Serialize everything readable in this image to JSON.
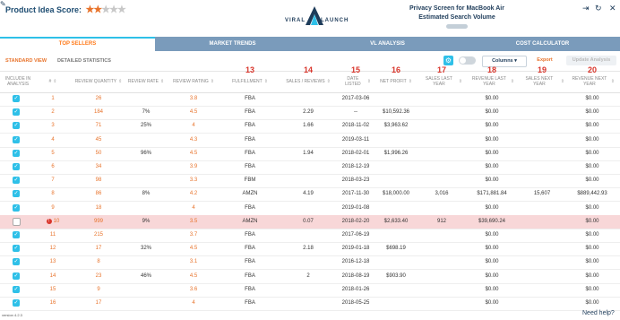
{
  "header": {
    "score_label": "Product Idea Score:",
    "stars": [
      "on",
      "on",
      "off",
      "off",
      "off"
    ],
    "logo_left": "VIRAL",
    "logo_right": "LAUNCH",
    "product_title": "Privacy Screen for MacBook Air",
    "product_subtitle": "Estimated Search Volume",
    "export_icon": "⇥",
    "refresh_icon": "↻",
    "close_icon": "✕"
  },
  "tabs": [
    {
      "label": "TOP SELLERS",
      "active": true
    },
    {
      "label": "MARKET TRENDS",
      "active": false
    },
    {
      "label": "VL ANALYSIS",
      "active": false
    },
    {
      "label": "COST CALCULATOR",
      "active": false
    }
  ],
  "toolbar": {
    "standard_view": "STANDARD VIEW",
    "detailed_statistics": "DETAILED STATISTICS",
    "gear_icon": "⚙",
    "columns_label": "Columns ▾",
    "export_label": "Export",
    "update_label": "Update Analysis"
  },
  "columns": {
    "include": "INCLUDE IN ANALYSIS",
    "num": "#",
    "review_qty": "REVIEW QUANTITY",
    "review_rate": "REVIEW RATE",
    "review_rating": "REVIEW RATING",
    "fulfillment": "FULFILLMENT",
    "sales_reviews": "SALES / REVIEWS",
    "date_listed": "DATE LISTED",
    "net_profit": "NET PROFIT",
    "sales_last_year": "SALES LAST YEAR",
    "revenue_last_year": "REVENUE LAST YEAR",
    "sales_next_year": "SALES NEXT YEAR",
    "revenue_next_year": "REVENUE NEXT YEAR"
  },
  "column_annotations": [
    "13",
    "14",
    "15",
    "16",
    "17",
    "18",
    "19",
    "20"
  ],
  "rows": [
    {
      "checked": true,
      "n": "1",
      "qty": "26",
      "rate": "",
      "rating": "3.8",
      "ful": "FBA",
      "sr": "",
      "date": "2017-03-06",
      "np": "",
      "sly": "",
      "rly": "$0.00",
      "sny": "",
      "rny": "$0.00"
    },
    {
      "checked": true,
      "n": "2",
      "qty": "184",
      "rate": "7%",
      "rating": "4.5",
      "ful": "FBA",
      "sr": "2.29",
      "date": "--",
      "np": "$10,592.36",
      "sly": "",
      "rly": "$0.00",
      "sny": "",
      "rny": "$0.00"
    },
    {
      "checked": true,
      "n": "3",
      "qty": "71",
      "rate": "25%",
      "rating": "4",
      "ful": "FBA",
      "sr": "1.66",
      "date": "2018-11-02",
      "np": "$3,963.62",
      "sly": "",
      "rly": "$0.00",
      "sny": "",
      "rny": "$0.00"
    },
    {
      "checked": true,
      "n": "4",
      "qty": "45",
      "rate": "",
      "rating": "4.3",
      "ful": "FBA",
      "sr": "",
      "date": "2019-03-11",
      "np": "",
      "sly": "",
      "rly": "$0.00",
      "sny": "",
      "rny": "$0.00"
    },
    {
      "checked": true,
      "n": "5",
      "qty": "50",
      "rate": "96%",
      "rating": "4.5",
      "ful": "FBA",
      "sr": "1.94",
      "date": "2018-02-01",
      "np": "$1,996.26",
      "sly": "",
      "rly": "$0.00",
      "sny": "",
      "rny": "$0.00"
    },
    {
      "checked": true,
      "n": "6",
      "qty": "34",
      "rate": "",
      "rating": "3.9",
      "ful": "FBA",
      "sr": "",
      "date": "2018-12-19",
      "np": "",
      "sly": "",
      "rly": "$0.00",
      "sny": "",
      "rny": "$0.00"
    },
    {
      "checked": true,
      "n": "7",
      "qty": "98",
      "rate": "",
      "rating": "3.3",
      "ful": "FBM",
      "sr": "",
      "date": "2018-03-23",
      "np": "",
      "sly": "",
      "rly": "$0.00",
      "sny": "",
      "rny": "$0.00"
    },
    {
      "checked": true,
      "n": "8",
      "qty": "86",
      "rate": "8%",
      "rating": "4.2",
      "ful": "AMZN",
      "sr": "4.19",
      "date": "2017-11-30",
      "np": "$18,000.00",
      "sly": "3,016",
      "rly": "$171,881.84",
      "sny": "15,607",
      "rny": "$889,442.93"
    },
    {
      "checked": true,
      "n": "9",
      "qty": "18",
      "rate": "",
      "rating": "4",
      "ful": "FBA",
      "sr": "",
      "date": "2019-01-08",
      "np": "",
      "sly": "",
      "rly": "$0.00",
      "sny": "",
      "rny": "$0.00"
    },
    {
      "checked": false,
      "alert": true,
      "n": "10",
      "qty": "999",
      "rate": "9%",
      "rating": "3.5",
      "ful": "AMZN",
      "sr": "0.07",
      "date": "2018-02-20",
      "np": "$2,633.40",
      "sly": "912",
      "rly": "$39,690.24",
      "sny": "",
      "rny": "$0.00"
    },
    {
      "checked": true,
      "n": "11",
      "qty": "215",
      "rate": "",
      "rating": "3.7",
      "ful": "FBA",
      "sr": "",
      "date": "2017-06-19",
      "np": "",
      "sly": "",
      "rly": "$0.00",
      "sny": "",
      "rny": "$0.00"
    },
    {
      "checked": true,
      "n": "12",
      "qty": "17",
      "rate": "32%",
      "rating": "4.5",
      "ful": "FBA",
      "sr": "2.18",
      "date": "2019-01-18",
      "np": "$698.19",
      "sly": "",
      "rly": "$0.00",
      "sny": "",
      "rny": "$0.00"
    },
    {
      "checked": true,
      "n": "13",
      "qty": "8",
      "rate": "",
      "rating": "3.1",
      "ful": "FBA",
      "sr": "",
      "date": "2016-12-18",
      "np": "",
      "sly": "",
      "rly": "$0.00",
      "sny": "",
      "rny": "$0.00"
    },
    {
      "checked": true,
      "n": "14",
      "qty": "23",
      "rate": "46%",
      "rating": "4.5",
      "ful": "FBA",
      "sr": "2",
      "date": "2018-08-19",
      "np": "$903.90",
      "sly": "",
      "rly": "$0.00",
      "sny": "",
      "rny": "$0.00"
    },
    {
      "checked": true,
      "n": "15",
      "qty": "9",
      "rate": "",
      "rating": "3.6",
      "ful": "FBA",
      "sr": "",
      "date": "2018-01-26",
      "np": "",
      "sly": "",
      "rly": "$0.00",
      "sny": "",
      "rny": "$0.00"
    },
    {
      "checked": true,
      "n": "16",
      "qty": "17",
      "rate": "",
      "rating": "4",
      "ful": "FBA",
      "sr": "",
      "date": "2018-05-25",
      "np": "",
      "sly": "",
      "rly": "$0.00",
      "sny": "",
      "rny": "$0.00"
    }
  ],
  "footer": {
    "version": "version 4.2.3",
    "help": "Need help?"
  },
  "colors": {
    "accent": "#2ec0e8",
    "orange": "#e8732b",
    "tab_bar": "#7a9bbb",
    "highlight_row": "#f8d7d8",
    "annotation": "#d9362c"
  }
}
